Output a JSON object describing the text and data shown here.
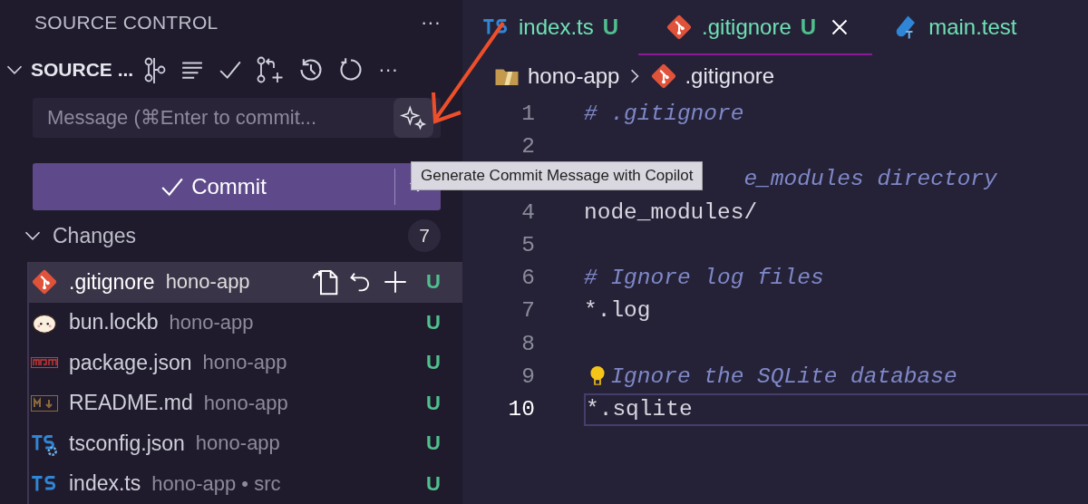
{
  "sidebar": {
    "title": "SOURCE CONTROL",
    "more": "···",
    "section": {
      "title": "SOURCE ...",
      "expanded": true,
      "more": "···"
    },
    "message": {
      "placeholder": "Message (⌘Enter to commit..."
    },
    "commit": {
      "label": "Commit"
    },
    "changes": {
      "title": "Changes",
      "expanded": true,
      "count": "7"
    },
    "files": [
      {
        "name": ".gitignore",
        "folder": "hono-app",
        "status": "U",
        "kind": "git",
        "selected": true
      },
      {
        "name": "bun.lockb",
        "folder": "hono-app",
        "status": "U",
        "kind": "bun",
        "selected": false
      },
      {
        "name": "package.json",
        "folder": "hono-app",
        "status": "U",
        "kind": "npm",
        "selected": false
      },
      {
        "name": "README.md",
        "folder": "hono-app",
        "status": "U",
        "kind": "markdown",
        "selected": false
      },
      {
        "name": "tsconfig.json",
        "folder": "hono-app",
        "status": "U",
        "kind": "tsconfig",
        "selected": false
      },
      {
        "name": "index.ts",
        "folder": "hono-app • src",
        "status": "U",
        "kind": "ts",
        "selected": false
      }
    ]
  },
  "tabs": [
    {
      "label": "index.ts",
      "status": "U",
      "kind": "ts",
      "selected": false
    },
    {
      "label": ".gitignore",
      "status": "U",
      "kind": "git",
      "selected": true
    },
    {
      "label": "main.test",
      "kind": "test",
      "selected": false
    }
  ],
  "breadcrumb": [
    {
      "label": "hono-app",
      "kind": "folder"
    },
    {
      "label": ".gitignore",
      "kind": "git"
    }
  ],
  "lines": [
    {
      "number": "1",
      "text": "# .gitignore",
      "kind": "comment",
      "current": false
    },
    {
      "number": "2",
      "kind": "plain",
      "current": false
    },
    {
      "text": "e_modules directory",
      "kind": "comment",
      "current": false
    },
    {
      "number": "4",
      "text": "node_modules/",
      "kind": "plain",
      "current": false
    },
    {
      "number": "5",
      "kind": "plain",
      "current": false
    },
    {
      "number": "6",
      "text": "# Ignore log files",
      "kind": "comment",
      "current": false
    },
    {
      "number": "7",
      "text": "*.log",
      "kind": "plain",
      "current": false
    },
    {
      "number": "8",
      "kind": "plain",
      "current": false
    },
    {
      "number": "9",
      "text": "Ignore the SQLite database",
      "kind": "comment",
      "lightbulb": true,
      "current": false
    },
    {
      "number": "10",
      "text": "*.sqlite",
      "kind": "plain",
      "current": true
    }
  ],
  "tooltip": "Generate Commit Message with Copilot"
}
